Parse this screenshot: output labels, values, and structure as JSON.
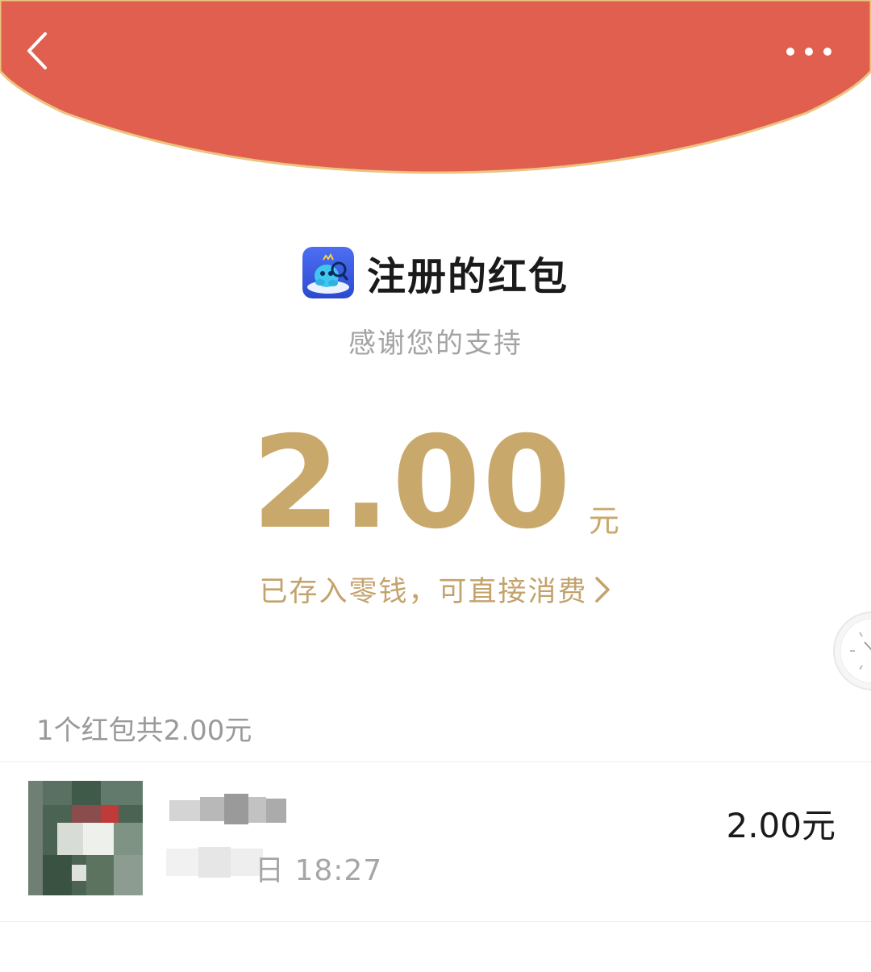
{
  "header": {
    "background_color": "#e15f4f",
    "border_color": "#eac480",
    "back_icon": "chevron-left-icon",
    "more_icon": "more-dots-icon"
  },
  "packet": {
    "sender_icon": "app-mascot-icon",
    "sender_title": "注册的红包",
    "subtitle": "感谢您的支持",
    "amount": "2.00",
    "amount_unit": "元",
    "wallet_link": "已存入零钱，可直接消费",
    "accent_color": "#c9a96b"
  },
  "records": {
    "summary": "1个红包共2.00元",
    "items": [
      {
        "time_partial": "日 18:27",
        "amount": "2.00元"
      }
    ]
  }
}
